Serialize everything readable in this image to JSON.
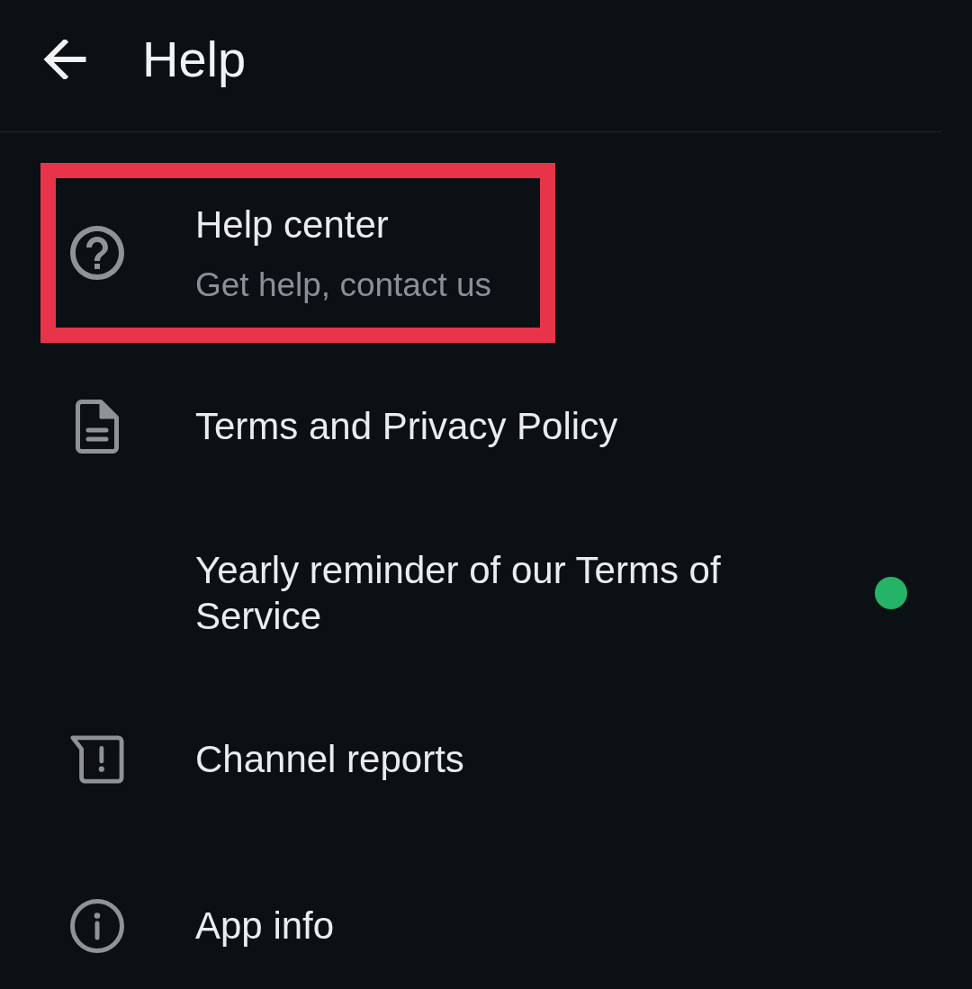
{
  "app_bar": {
    "title": "Help"
  },
  "items": [
    {
      "title": "Help center",
      "subtitle": "Get help, contact us",
      "highlighted": true,
      "unread_dot": false
    },
    {
      "title": "Terms and Privacy Policy",
      "highlighted": false,
      "unread_dot": false
    },
    {
      "title": "Yearly reminder of our Terms of Service",
      "highlighted": false,
      "unread_dot": true
    },
    {
      "title": "Channel reports",
      "highlighted": false,
      "unread_dot": false
    },
    {
      "title": "App info",
      "highlighted": false,
      "unread_dot": false
    }
  ]
}
